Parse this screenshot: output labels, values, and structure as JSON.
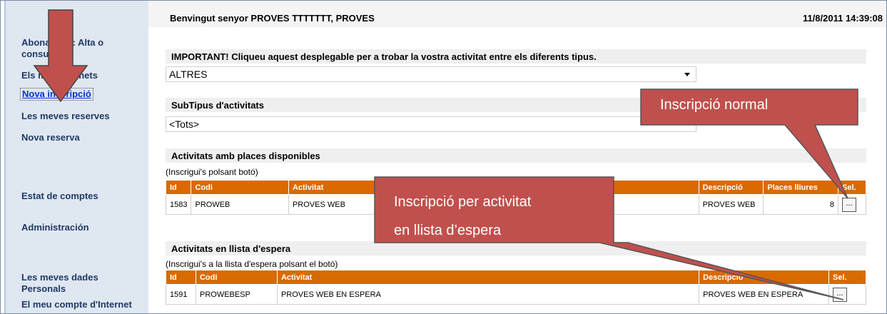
{
  "header": {
    "welcome": "Benvingut senyor PROVES TTTTTTT, PROVES",
    "datetime": "11/8/2011 14:39:08"
  },
  "sidebar": {
    "items": [
      {
        "label": "Abonament: Alta o consulta"
      },
      {
        "label": "Els meus carnets"
      },
      {
        "label": "Nova inscripció"
      },
      {
        "label": "Les meves reserves"
      },
      {
        "label": "Nova reserva"
      },
      {
        "label": "Estat de comptes"
      },
      {
        "label": "Administración"
      },
      {
        "label": "Les meves dades Personals"
      },
      {
        "label": "El meu compte d'Internet"
      }
    ]
  },
  "filters": {
    "important_label": "IMPORTANT! Cliqueu aquest desplegable per a trobar la vostra activitat entre els diferents tipus.",
    "tipus_value": "ALTRES",
    "subtipus_label": "SubTipus d'activitats",
    "subtipus_value": "<Tots>"
  },
  "available": {
    "title": "Activitats amb places disponibles",
    "hint": "(Inscrigui's polsant botó)",
    "columns": [
      "Id",
      "Codi",
      "Activitat",
      "Descripció",
      "Places lliures",
      "Sel."
    ],
    "rows": [
      {
        "id": "1583",
        "codi": "PROWEB",
        "activitat": "PROVES WEB",
        "descripcio": "PROVES WEB",
        "places": "8",
        "sel": "..."
      }
    ]
  },
  "waiting": {
    "title": "Activitats en llista d'espera",
    "hint": "(Inscrigui's a la llista d'espera polsant el botó)",
    "columns": [
      "Id",
      "Codi",
      "Activitat",
      "Descripció",
      "Sel."
    ],
    "rows": [
      {
        "id": "1591",
        "codi": "PROWEBESP",
        "activitat": "PROVES WEB EN ESPERA",
        "descripcio": "PROVES WEB EN ESPERA",
        "sel": "..."
      }
    ]
  },
  "annotations": {
    "callout_normal": "Inscripció normal",
    "callout_waiting_line1": "Inscripció per activitat",
    "callout_waiting_line2": "en llista d’espera",
    "callout_color": "#c0504d"
  }
}
